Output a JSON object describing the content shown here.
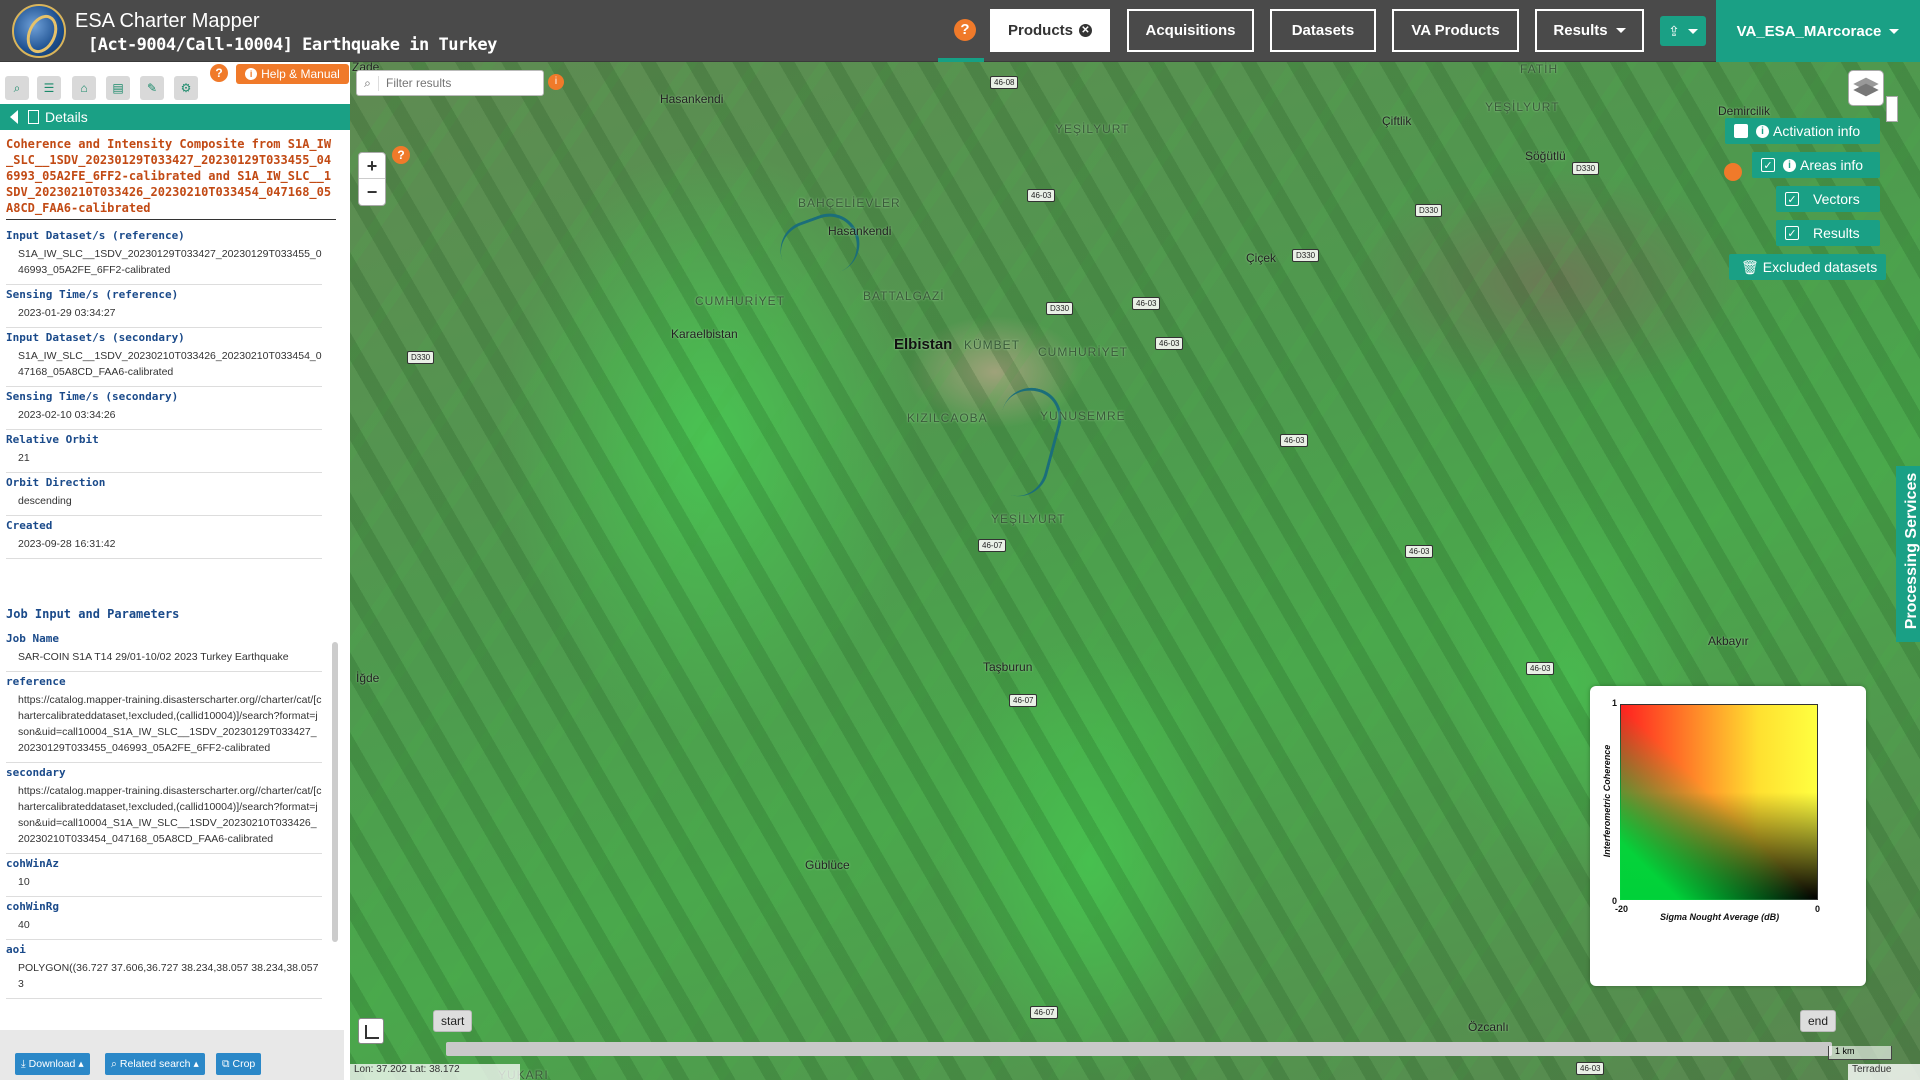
{
  "header": {
    "app_title": "ESA Charter Mapper",
    "activation_title": "[Act-9004/Call-10004] Earthquake in Turkey",
    "help_glyph": "?",
    "nav": [
      {
        "label": "Products",
        "active": true
      },
      {
        "label": "Acquisitions"
      },
      {
        "label": "Datasets"
      },
      {
        "label": "VA Products"
      },
      {
        "label": "Results"
      }
    ],
    "user": "VA_ESA_MArcorace"
  },
  "sidebar": {
    "help_manual": "Help & Manual",
    "details_label": "Details",
    "product_title": "Coherence and Intensity Composite from S1A_IW_SLC__1SDV_20230129T033427_20230129T033455_046993_05A2FE_6FF2-calibrated and S1A_IW_SLC__1SDV_20230210T033426_20230210T033454_047168_05A8CD_FAA6-calibrated",
    "fields": [
      {
        "label": "Input Dataset/s (reference)",
        "value": "S1A_IW_SLC__1SDV_20230129T033427_20230129T033455_046993_05A2FE_6FF2-calibrated"
      },
      {
        "label": "Sensing Time/s (reference)",
        "value": "2023-01-29 03:34:27"
      },
      {
        "label": "Input Dataset/s (secondary)",
        "value": "S1A_IW_SLC__1SDV_20230210T033426_20230210T033454_047168_05A8CD_FAA6-calibrated"
      },
      {
        "label": "Sensing Time/s (secondary)",
        "value": "2023-02-10 03:34:26"
      },
      {
        "label": "Relative Orbit",
        "value": "21"
      },
      {
        "label": "Orbit Direction",
        "value": "descending"
      },
      {
        "label": "Created",
        "value": "2023-09-28 16:31:42"
      }
    ],
    "job_section": "Job Input and Parameters",
    "job_fields": [
      {
        "label": "Job Name",
        "value": "SAR-COIN S1A T14 29/01-10/02 2023 Turkey Earthquake"
      },
      {
        "label": "reference",
        "value": "https://catalog.mapper-training.disasterscharter.org//charter/cat/[chartercalibrateddataset,!excluded,(callid10004)]/search?format=json&uid=call10004_S1A_IW_SLC__1SDV_20230129T033427_20230129T033455_046993_05A2FE_6FF2-calibrated"
      },
      {
        "label": "secondary",
        "value": "https://catalog.mapper-training.disasterscharter.org//charter/cat/[chartercalibrateddataset,!excluded,(callid10004)]/search?format=json&uid=call10004_S1A_IW_SLC__1SDV_20230210T033426_20230210T033454_047168_05A8CD_FAA6-calibrated"
      },
      {
        "label": "cohWinAz",
        "value": "10"
      },
      {
        "label": "cohWinRg",
        "value": "40"
      },
      {
        "label": "aoi",
        "value": "POLYGON((36.727 37.606,36.727 38.234,38.057 38.234,38.057 3"
      }
    ],
    "footer": {
      "download": "Download",
      "related": "Related search",
      "crop": "Crop"
    }
  },
  "map": {
    "filter_placeholder": "Filter results",
    "zoom_in": "+",
    "zoom_out": "−",
    "overlays": {
      "activation_info": "Activation info",
      "areas_info": "Areas info",
      "vectors": "Vectors",
      "results": "Results",
      "excluded": "Excluded datasets"
    },
    "processing_services": "Processing Services",
    "legend": {
      "y_label": "Interferometric Coherence",
      "x_label": "Sigma Nought Average (dB)",
      "y_max": "1",
      "y_min": "0",
      "x_min": "-20",
      "x_max": "0"
    },
    "timeline": {
      "start": "start",
      "end": "end"
    },
    "scale": "1 km",
    "attribution": "Terradue",
    "coords": "Lon: 37.202 Lat: 38.172",
    "places": [
      {
        "name": "Hasankendi"
      },
      {
        "name": "YEŞİLYURT"
      },
      {
        "name": "Çiftlik"
      },
      {
        "name": "YEŞİLYURT"
      },
      {
        "name": "FATİH"
      },
      {
        "name": "Demircilik"
      },
      {
        "name": "Söğütlü"
      },
      {
        "name": "BAHÇELİEVLER"
      },
      {
        "name": "Hasankendi"
      },
      {
        "name": "Çiçek"
      },
      {
        "name": "CUMHURİYET"
      },
      {
        "name": "BATTALGAZİ"
      },
      {
        "name": "Karaelbistan"
      },
      {
        "name": "Elbistan"
      },
      {
        "name": "KÜMBET"
      },
      {
        "name": "CUMHURİYET"
      },
      {
        "name": "KIZILCAOBA"
      },
      {
        "name": "YUNUSEMRE"
      },
      {
        "name": "YEŞİLYURT"
      },
      {
        "name": "Akbayır"
      },
      {
        "name": "Taşburun"
      },
      {
        "name": "İğde"
      },
      {
        "name": "Güblüce"
      },
      {
        "name": "Özcanlı"
      },
      {
        "name": "YUKARI"
      },
      {
        "name": "Zade"
      }
    ],
    "roads": [
      "46-08",
      "46-03",
      "D330",
      "D330",
      "D330",
      "D330",
      "D330",
      "46-03",
      "46-03",
      "46-03",
      "46-07",
      "46-03",
      "46-03",
      "46-07",
      "46-07",
      "46-03"
    ]
  }
}
